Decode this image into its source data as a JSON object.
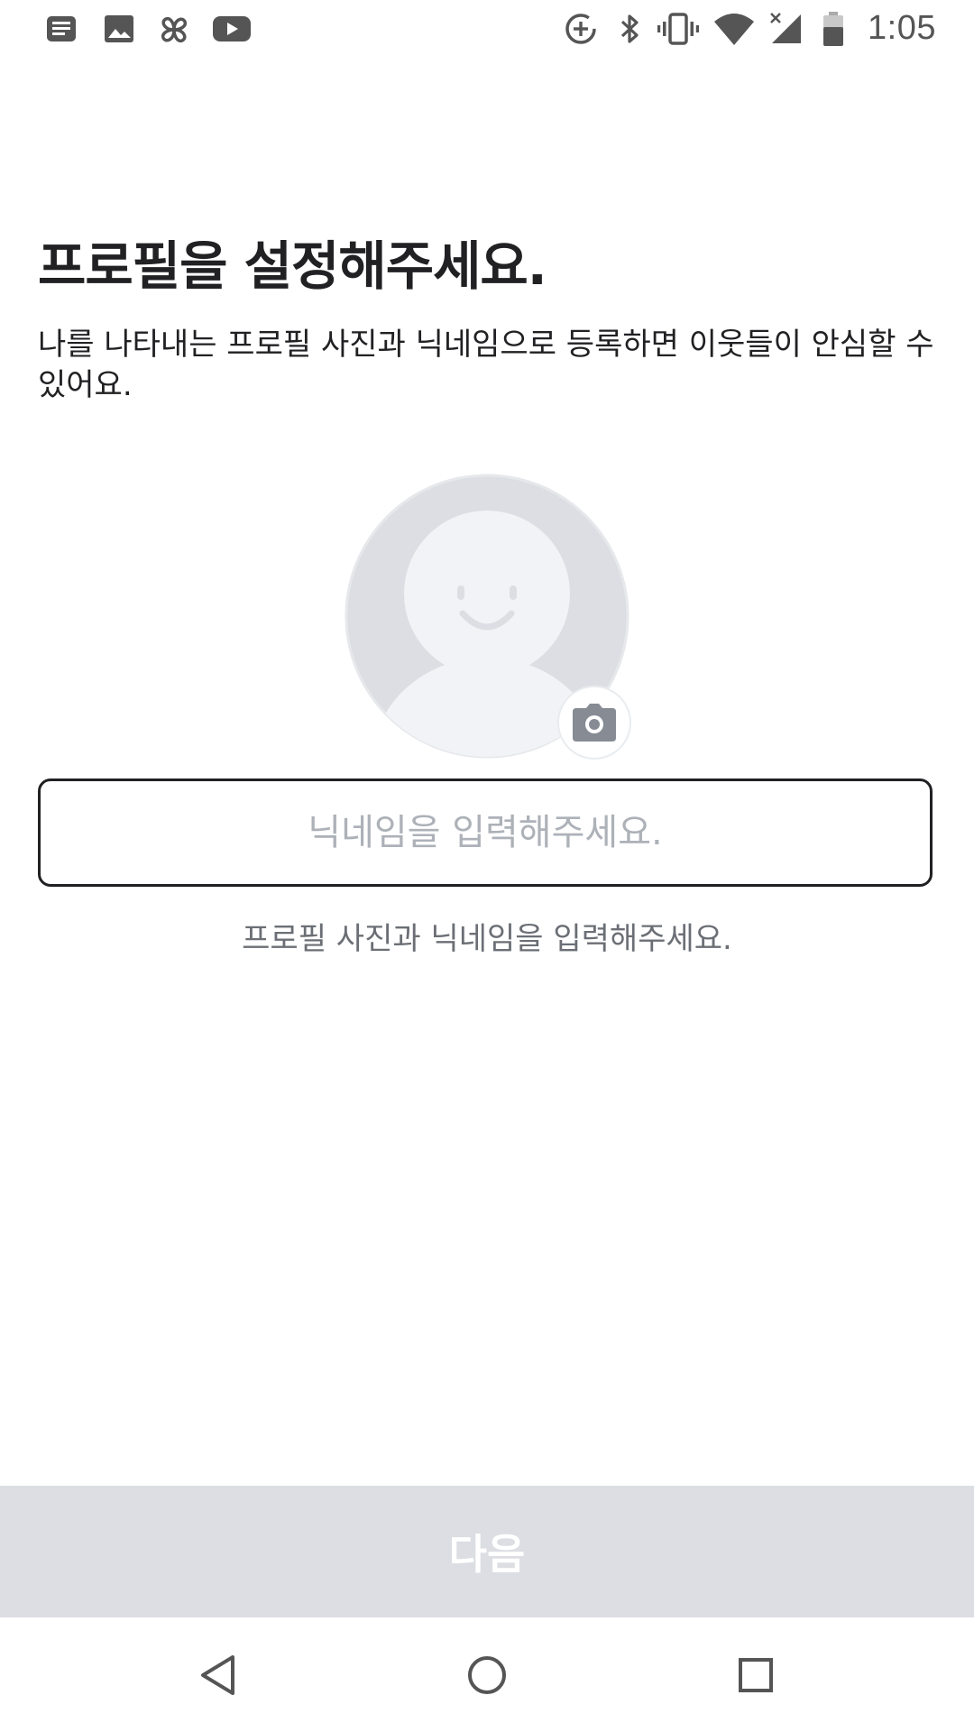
{
  "status_bar": {
    "time": "1:05",
    "left_icons": [
      "notification-news-icon",
      "gallery-icon",
      "pinwheel-icon",
      "youtube-icon"
    ],
    "right_icons": [
      "data-saver-icon",
      "bluetooth-icon",
      "vibrate-icon",
      "wifi-icon",
      "cell-signal-icon",
      "battery-icon"
    ]
  },
  "page": {
    "title": "프로필을 설정해주세요.",
    "description": "나를 나타내는 프로필 사진과 닉네임으로 등록하면 이웃들이 안심할 수 있어요."
  },
  "profile": {
    "avatar_icon": "default-avatar-icon",
    "camera_icon": "camera-icon"
  },
  "nickname": {
    "value": "",
    "placeholder": "닉네임을 입력해주세요."
  },
  "helper": {
    "text": "프로필 사진과 닉네임을 입력해주세요."
  },
  "actions": {
    "next_label": "다음",
    "next_enabled": false
  },
  "colors": {
    "button_disabled_bg": "#dcdee3",
    "placeholder": "#adb1b8",
    "avatar_bg": "#dcdee3",
    "avatar_figure": "#f2f3f6"
  },
  "nav_bar": {
    "icons": [
      "back-triangle-icon",
      "home-circle-icon",
      "recents-square-icon"
    ]
  }
}
